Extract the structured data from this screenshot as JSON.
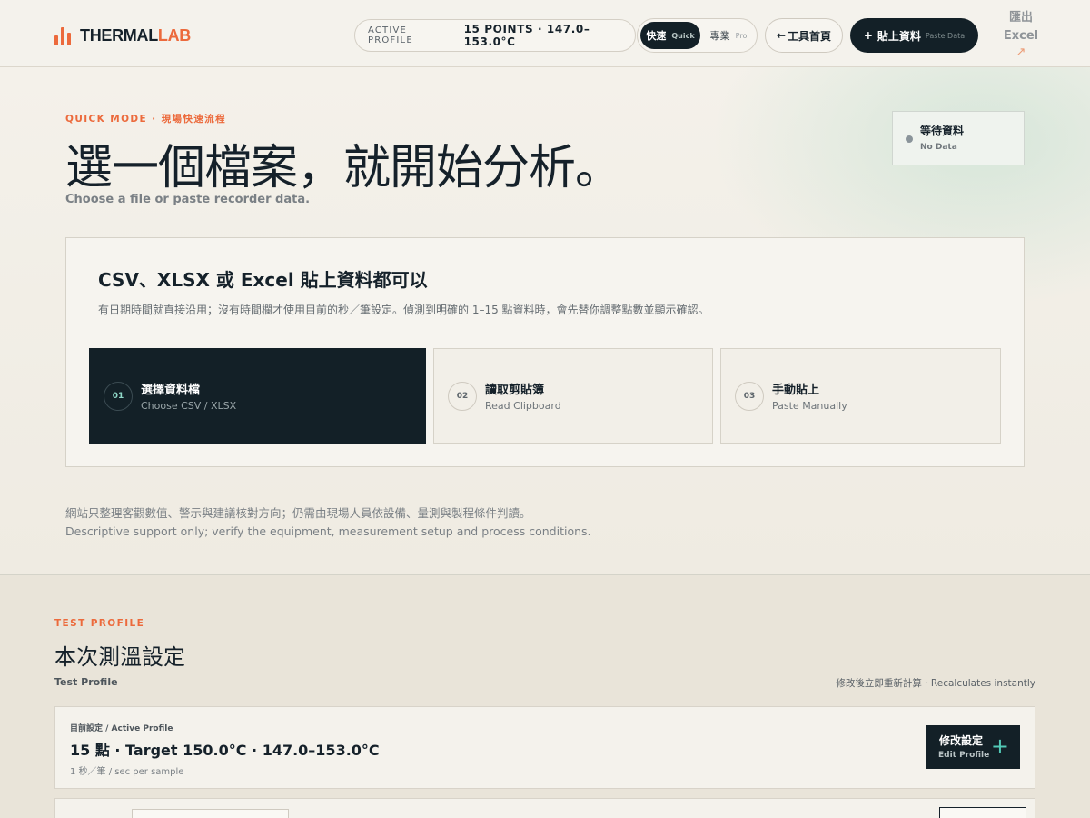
{
  "header": {
    "brand_part1": "THERMAL",
    "brand_part2": "LAB",
    "profile_label": "ACTIVE PROFILE",
    "profile_value": "15 POINTS · 147.0–153.0°C",
    "mode_quick": "快速",
    "mode_quick_en": "Quick",
    "mode_pro": "專業",
    "mode_pro_en": "Pro",
    "home_arrow": "←",
    "home_label": "工具首頁",
    "paste_plus": "+",
    "paste_label": "貼上資料",
    "paste_en": "Paste Data",
    "export_zh": "匯出",
    "export_en": "Excel",
    "export_arrow": "↗"
  },
  "hero": {
    "eyebrow": "QUICK MODE · 現場快速流程",
    "title": "選一個檔案，就開始分析。",
    "subtitle": "Choose a file or paste recorder data.",
    "status_title": "等待資料",
    "status_sub": "No Data",
    "status_dot_color": "#8a949a"
  },
  "upload": {
    "title": "CSV、XLSX 或 Excel 貼上資料都可以",
    "description": "有日期時間就直接沿用；沒有時間欄才使用目前的秒／筆設定。偵測到明確的 1–15 點資料時，會先替你調整點數並顯示確認。",
    "actions": [
      {
        "num": "01",
        "label": "選擇資料檔",
        "sub": "Choose CSV / XLSX"
      },
      {
        "num": "02",
        "label": "讀取剪貼簿",
        "sub": "Read Clipboard"
      },
      {
        "num": "03",
        "label": "手動貼上",
        "sub": "Paste Manually"
      }
    ]
  },
  "disclaimer": {
    "zh": "網站只整理客觀數值、警示與建議核對方向；仍需由現場人員依設備、量測與製程條件判讀。",
    "en": "Descriptive support only; verify the equipment, measurement setup and process conditions."
  },
  "profile_section": {
    "eyebrow": "TEST PROFILE",
    "title": "本次測溫設定",
    "subtitle": "Test Profile",
    "note": "修改後立即重新計算 · Recalculates instantly",
    "card_label": "目前設定 / Active Profile",
    "card_value": "15 點 · Target 150.0°C · 147.0–153.0°C",
    "card_sub": "1 秒／筆 / sec per sample",
    "edit_label": "修改設定",
    "edit_en": "Edit Profile",
    "edit_plus": "+"
  },
  "colors": {
    "accent": "#ec6a3c",
    "dark": "#132027",
    "teal": "#52c9b6"
  }
}
